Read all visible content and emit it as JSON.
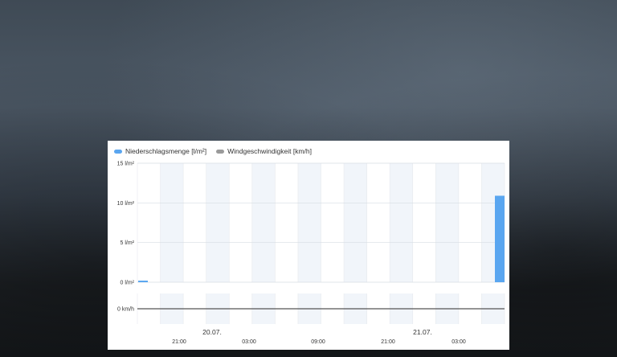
{
  "legend": {
    "precip_label": "Niederschlagsmenge [l/m²]",
    "wind_label": "Windgeschwindigkeit [km/h]"
  },
  "colors": {
    "precip": "#5aa6f0",
    "wind": "#9a9a9a"
  },
  "chart_data": {
    "type": "bar",
    "x_tick_labels": [
      "21:00",
      "03:00",
      "09:00",
      "21:00",
      "03:00"
    ],
    "date_labels": [
      "20.07.",
      "21.07."
    ],
    "precip": {
      "name": "Niederschlagsmenge [l/m²]",
      "y_ticks": [
        "15 l/m²",
        "10 l/m²",
        "5 l/m²",
        "0 l/m²"
      ],
      "ylim": [
        0,
        15
      ],
      "values": [
        0.2,
        0,
        0,
        0,
        0,
        0,
        0,
        0,
        0,
        0,
        0,
        0,
        0,
        0,
        0,
        0,
        10.9
      ]
    },
    "wind": {
      "name": "Windgeschwindigkeit [km/h]",
      "y_ticks": [
        "0 km/h"
      ],
      "values": [
        0,
        0,
        0,
        0,
        0,
        0,
        0,
        0,
        0,
        0,
        0,
        0,
        0,
        0,
        0,
        0,
        0
      ]
    }
  }
}
